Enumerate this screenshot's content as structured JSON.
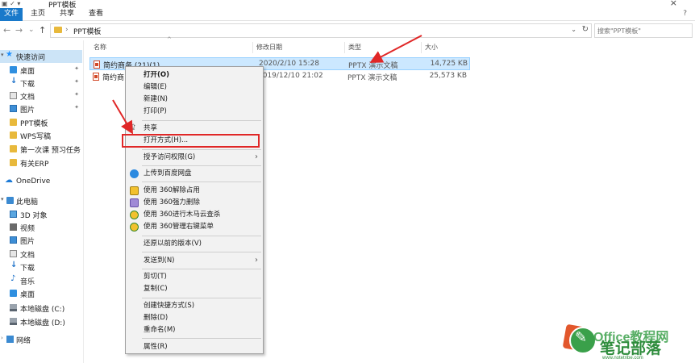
{
  "window": {
    "title": "PPT模板",
    "close_glyph": "×",
    "ribbon_tabs": [
      "文件",
      "主页",
      "共享",
      "查看"
    ],
    "help_glyph": "?"
  },
  "nav": {
    "back": "←",
    "forward": "→",
    "recent": "⌄",
    "up": "↑",
    "path_separator": "›",
    "path": "PPT模板",
    "dropdown": "⌄",
    "refresh": "↻",
    "search_placeholder": "搜索\"PPT模板\""
  },
  "sidebar": {
    "quick_access": "快速访问",
    "items": [
      {
        "label": "桌面",
        "icon": "desktop-icon",
        "pinned": true
      },
      {
        "label": "下载",
        "icon": "download-icon",
        "pinned": true
      },
      {
        "label": "文档",
        "icon": "document-icon",
        "pinned": true
      },
      {
        "label": "图片",
        "icon": "pictures-icon",
        "pinned": true
      },
      {
        "label": "PPT模板",
        "icon": "folder-icon",
        "pinned": false
      },
      {
        "label": "WPS写稿",
        "icon": "folder-icon",
        "pinned": false
      },
      {
        "label": "第一次课 预习任务",
        "icon": "folder-icon",
        "pinned": false
      },
      {
        "label": "有关ERP",
        "icon": "folder-icon",
        "pinned": false
      }
    ],
    "onedrive": "OneDrive",
    "this_pc": "此电脑",
    "pc_items": [
      {
        "label": "3D 对象",
        "icon": "3d-objects-icon"
      },
      {
        "label": "视频",
        "icon": "videos-icon"
      },
      {
        "label": "图片",
        "icon": "pictures-icon"
      },
      {
        "label": "文档",
        "icon": "document-icon"
      },
      {
        "label": "下载",
        "icon": "download-icon"
      },
      {
        "label": "音乐",
        "icon": "music-icon"
      },
      {
        "label": "桌面",
        "icon": "desktop-icon"
      },
      {
        "label": "本地磁盘 (C:)",
        "icon": "drive-icon"
      },
      {
        "label": "本地磁盘 (D:)",
        "icon": "drive-icon"
      }
    ],
    "network": "网络",
    "pin_glyph": "📌"
  },
  "columns": {
    "name": "名称",
    "date": "修改日期",
    "type": "类型",
    "size": "大小"
  },
  "files": [
    {
      "name": "简约商务 (21)(1)",
      "date": "2020/2/10 15:28",
      "type": "PPTX 演示文稿",
      "size": "14,725 KB",
      "selected": true
    },
    {
      "name": "简约商",
      "date": "2019/12/10 21:02",
      "type": "PPTX 演示文稿",
      "size": "25,573 KB",
      "selected": false
    }
  ],
  "context_menu": {
    "groups": [
      [
        {
          "label": "打开(O)",
          "bold": true
        },
        {
          "label": "编辑(E)"
        },
        {
          "label": "新建(N)"
        },
        {
          "label": "打印(P)"
        }
      ],
      [
        {
          "label": "共享",
          "icon": "share-icon"
        },
        {
          "label": "打开方式(H)..."
        }
      ],
      [
        {
          "label": "授予访问权限(G)",
          "submenu": true
        }
      ],
      [
        {
          "label": "上传到百度网盘",
          "icon": "baidu-netdisk-icon"
        }
      ],
      [
        {
          "label": "使用 360解除占用",
          "icon": "360-unlock-icon"
        },
        {
          "label": "使用 360强力删除",
          "icon": "360-shred-icon"
        },
        {
          "label": "使用 360进行木马云查杀",
          "icon": "360-scan-icon"
        },
        {
          "label": "使用 360管理右键菜单",
          "icon": "360-menu-icon"
        }
      ],
      [
        {
          "label": "还原以前的版本(V)"
        }
      ],
      [
        {
          "label": "发送到(N)",
          "submenu": true
        }
      ],
      [
        {
          "label": "剪切(T)"
        },
        {
          "label": "复制(C)"
        }
      ],
      [
        {
          "label": "创建快捷方式(S)"
        },
        {
          "label": "删除(D)"
        },
        {
          "label": "重命名(M)"
        }
      ],
      [
        {
          "label": "属性(R)"
        }
      ]
    ],
    "submenu_glyph": "›",
    "highlighted_item": "打开方式(H)..."
  },
  "watermark": {
    "line1": "Office教程网",
    "line2": "笔记部落",
    "url": "www.notetribe.com"
  },
  "colors": {
    "accent": "#1979ca",
    "selection": "#cce8ff",
    "annotation": "#e02727"
  }
}
